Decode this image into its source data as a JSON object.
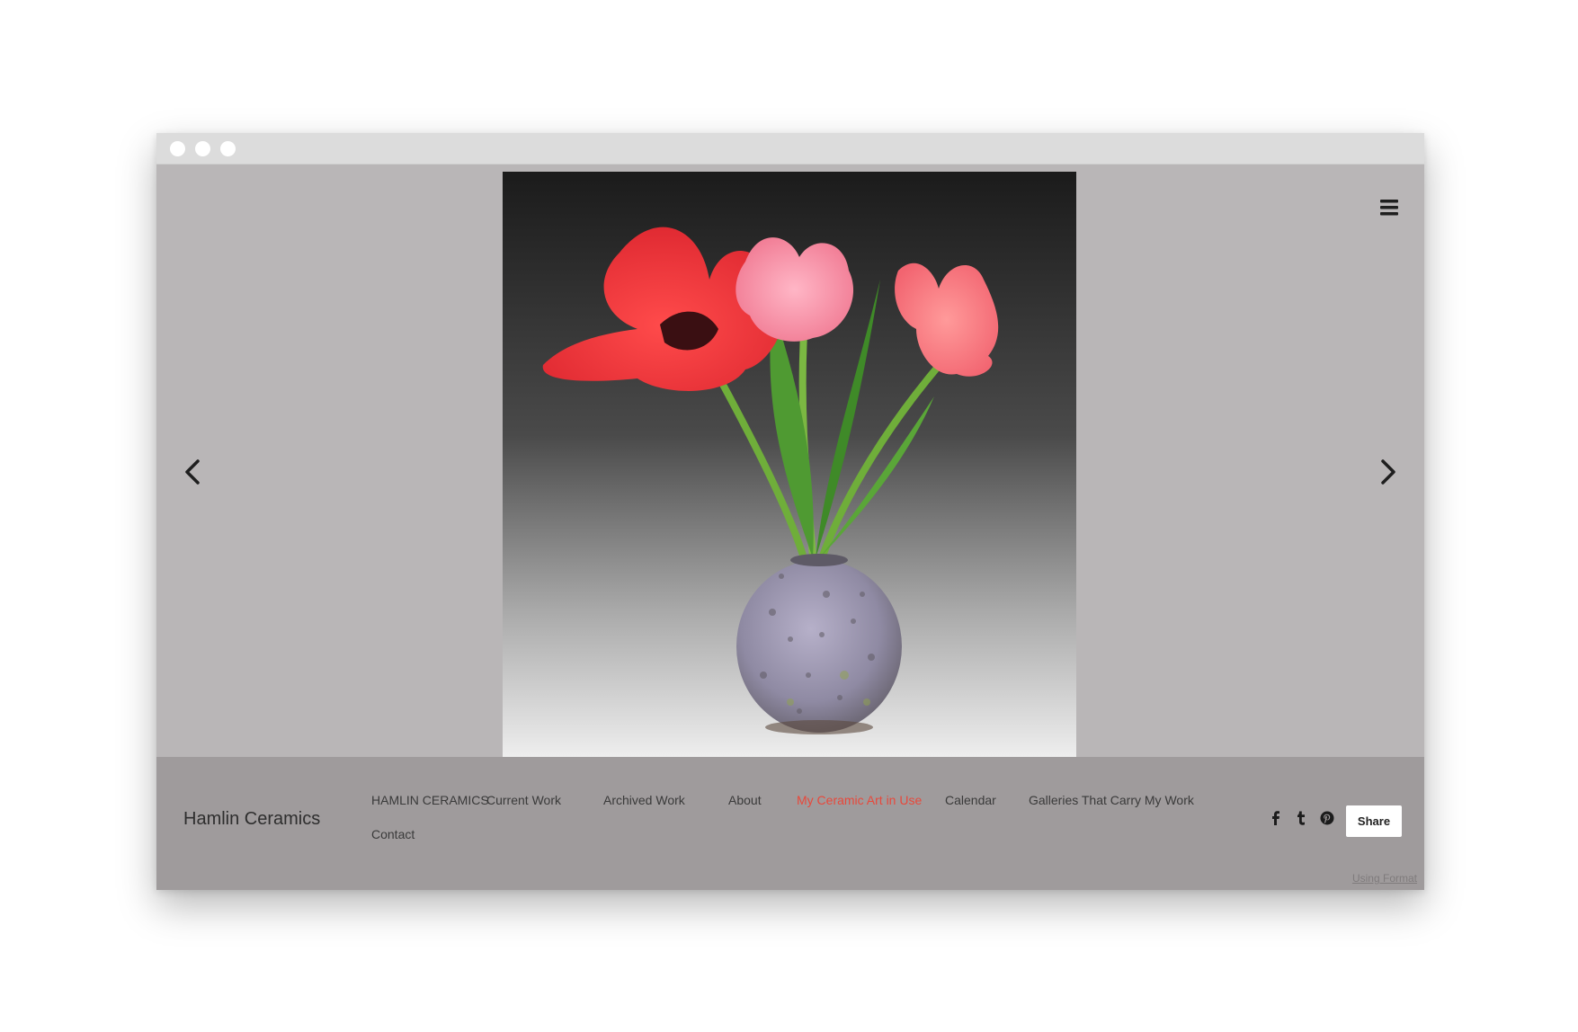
{
  "site": {
    "brand": "Hamlin Ceramics"
  },
  "nav": {
    "items": [
      {
        "label": "HAMLIN CERAMICS"
      },
      {
        "label": "Current Work"
      },
      {
        "label": "Archived Work"
      },
      {
        "label": "About"
      },
      {
        "label": "My Ceramic Art in Use",
        "active": true
      },
      {
        "label": "Calendar"
      },
      {
        "label": "Galleries That Carry My Work"
      },
      {
        "label": "Contact"
      }
    ]
  },
  "gallery": {
    "image": "photo of three pink-red tulips in a round speckled lavender ceramic vase",
    "prev_icon": "chevron-left-icon",
    "next_icon": "chevron-right-icon"
  },
  "header": {
    "menu_icon": "hamburger-menu-icon"
  },
  "social": {
    "icons": [
      "facebook-icon",
      "tumblr-icon",
      "pinterest-icon"
    ],
    "share_label": "Share"
  },
  "footer": {
    "credit": "Using Format"
  },
  "colors": {
    "stage_bg": "#b9b6b7",
    "footer_bg": "#9f9b9c",
    "active_nav": "#e8483b"
  }
}
